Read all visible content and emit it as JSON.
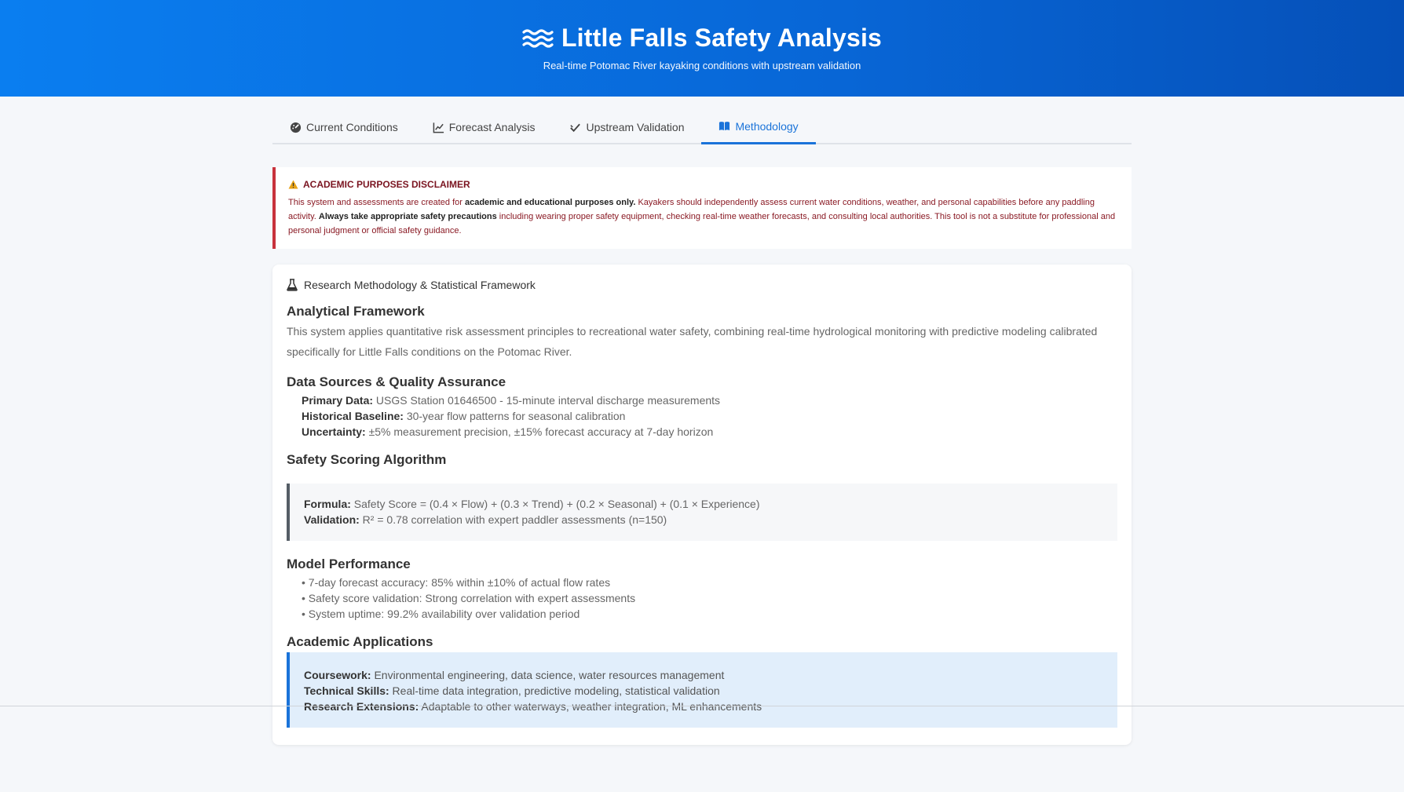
{
  "header": {
    "title": "Little Falls Safety Analysis",
    "subtitle": "Real-time Potomac River kayaking conditions with upstream validation"
  },
  "tabs": [
    {
      "label": "Current Conditions",
      "icon": "gauge-icon",
      "active": false
    },
    {
      "label": "Forecast Analysis",
      "icon": "line-chart-icon",
      "active": false
    },
    {
      "label": "Upstream Validation",
      "icon": "check-double-icon",
      "active": false
    },
    {
      "label": "Methodology",
      "icon": "book-icon",
      "active": true
    }
  ],
  "disclaimer": {
    "title": "ACADEMIC PURPOSES DISCLAIMER",
    "t1": "This system and assessments are created for ",
    "b1": "academic and educational purposes only.",
    "t2": " Kayakers should independently assess current water conditions, weather, and personal capabilities before any paddling activity. ",
    "b2": "Always take appropriate safety precautions",
    "t3": " including wearing proper safety equipment, checking real-time weather forecasts, and consulting local authorities. This tool is not a substitute for professional and personal judgment or official safety guidance."
  },
  "methodology": {
    "card_title": "Research Methodology & Statistical Framework",
    "framework": {
      "heading": "Analytical Framework",
      "text": "This system applies quantitative risk assessment principles to recreational water safety, combining real-time hydrological monitoring with predictive modeling calibrated specifically for Little Falls conditions on the Potomac River."
    },
    "data_sources": {
      "heading": "Data Sources & Quality Assurance",
      "primary_label": "Primary Data:",
      "primary_value": " USGS Station 01646500 - 15-minute interval discharge measurements",
      "historical_label": "Historical Baseline:",
      "historical_value": " 30-year flow patterns for seasonal calibration",
      "uncertainty_label": "Uncertainty:",
      "uncertainty_value": " ±5% measurement precision, ±15% forecast accuracy at 7-day horizon"
    },
    "scoring": {
      "heading": "Safety Scoring Algorithm",
      "formula_label": "Formula:",
      "formula_value": " Safety Score = (0.4 × Flow) + (0.3 × Trend) + (0.2 × Seasonal) + (0.1 × Experience)",
      "validation_label": "Validation:",
      "validation_value": " R² = 0.78 correlation with expert paddler assessments (n=150)"
    },
    "performance": {
      "heading": "Model Performance",
      "items": [
        "• 7-day forecast accuracy: 85% within ±10% of actual flow rates",
        "• Safety score validation: Strong correlation with expert assessments",
        "• System uptime: 99.2% availability over validation period"
      ]
    },
    "applications": {
      "heading": "Academic Applications",
      "coursework_label": "Coursework:",
      "coursework_value": " Environmental engineering, data science, water resources management",
      "technical_label": "Technical Skills:",
      "technical_value": " Real-time data integration, predictive modeling, statistical validation",
      "research_label": "Research Extensions:",
      "research_value": " Adaptable to other waterways, weather integration, ML enhancements"
    }
  },
  "colors": {
    "header_blue": "#0a7ef0",
    "accent": "#1a73d9",
    "disclaimer_red": "#c8323c"
  }
}
